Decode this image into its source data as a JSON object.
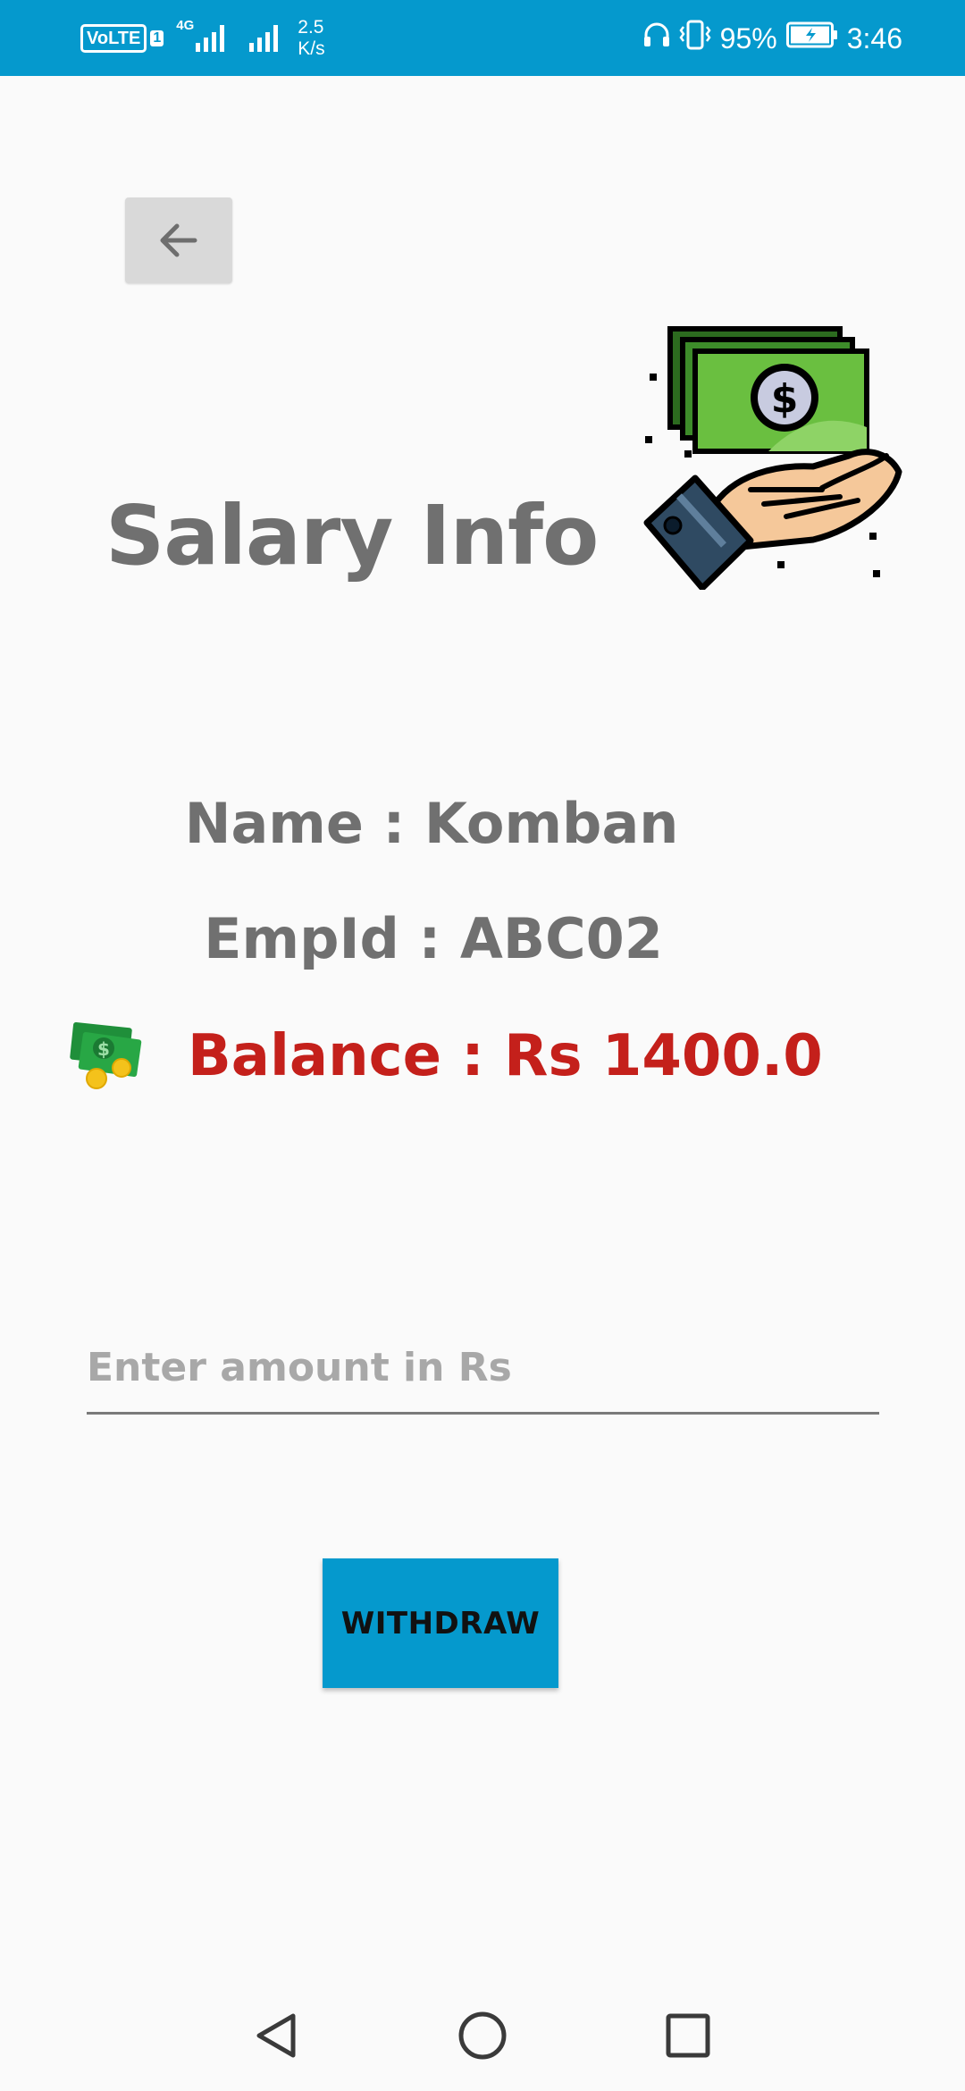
{
  "status_bar": {
    "volte_label": "VoLTE",
    "sim_slot": "1",
    "network_type": "4G",
    "speed_value": "2.5",
    "speed_unit": "K/s",
    "battery_percent": "95%",
    "time": "3:46",
    "background_color": "#0599cd",
    "icons": [
      "headphone-icon",
      "vibrate-icon",
      "battery-icon"
    ]
  },
  "header": {
    "back_icon": "arrow-left-icon",
    "title": "Salary Info",
    "illustration": "money-hand-icon"
  },
  "employee": {
    "name_line": "Name : Komban",
    "emp_id_line": "EmpId : ABC02",
    "balance_line": "Balance : Rs 1400.0",
    "balance_icon": "cash-icon",
    "balance_color": "#c4201b"
  },
  "form": {
    "amount_placeholder": "Enter amount in Rs",
    "amount_value": "",
    "withdraw_label": "WITHDRAW",
    "button_color": "#0599cd"
  },
  "nav_bar": {
    "icons": [
      "nav-back-icon",
      "nav-home-icon",
      "nav-recents-icon"
    ]
  }
}
